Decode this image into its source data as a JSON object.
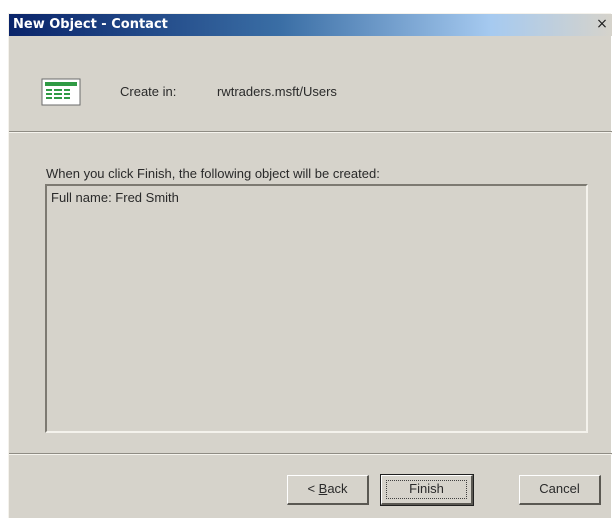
{
  "window": {
    "title": "New Object - Contact",
    "close_glyph": "×"
  },
  "header": {
    "icon": "contact-card-icon",
    "create_in_label": "Create in:",
    "create_in_value": "rwtraders.msft/Users"
  },
  "body": {
    "info_text": "When you click Finish, the following object will be created:",
    "summary": {
      "lines": [
        "Full name: Fred Smith"
      ]
    }
  },
  "buttons": {
    "back": {
      "accesskey": "B",
      "rest": "ack"
    },
    "back_prefix": "< ",
    "finish_label": "Finish",
    "cancel_label": "Cancel"
  },
  "colors": {
    "dialog_bg": "#d6d3cb",
    "titlebar_start": "#0a246a",
    "titlebar_end": "#a6caf0",
    "icon_green": "#2f9a44"
  }
}
